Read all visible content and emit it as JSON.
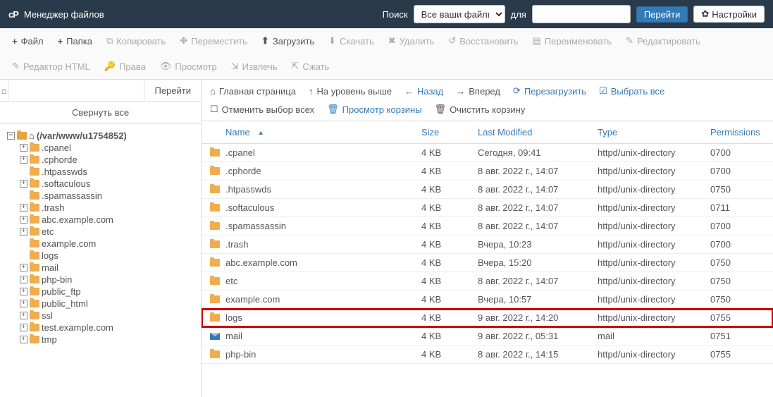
{
  "header": {
    "title": "Менеджер файлов",
    "searchLabel": "Поиск",
    "scopeSelected": "Все ваши файлы",
    "forLabel": "для",
    "goLabel": "Перейти",
    "settingsLabel": "Настройки"
  },
  "toolbar": {
    "file": "Файл",
    "folder": "Папка",
    "copy": "Копировать",
    "move": "Переместить",
    "upload": "Загрузить",
    "download": "Скачать",
    "delete": "Удалить",
    "restore": "Восстановить",
    "rename": "Переименовать",
    "edit": "Редактировать",
    "htmlEditor": "Редактор HTML",
    "perms": "Права",
    "view": "Просмотр",
    "extract": "Извлечь",
    "compress": "Сжать"
  },
  "left": {
    "goLabel": "Перейти",
    "collapseAll": "Свернуть все",
    "rootLabel": "(/var/www/u1754852)",
    "tree": [
      {
        "label": ".cpanel",
        "exp": "+"
      },
      {
        "label": ".cphorde",
        "exp": "+"
      },
      {
        "label": ".htpasswds",
        "exp": ""
      },
      {
        "label": ".softaculous",
        "exp": "+"
      },
      {
        "label": ".spamassassin",
        "exp": ""
      },
      {
        "label": ".trash",
        "exp": "+"
      },
      {
        "label": "abc.example.com",
        "exp": "+"
      },
      {
        "label": "etc",
        "exp": "+"
      },
      {
        "label": "example.com",
        "exp": ""
      },
      {
        "label": "logs",
        "exp": ""
      },
      {
        "label": "mail",
        "exp": "+"
      },
      {
        "label": "php-bin",
        "exp": "+"
      },
      {
        "label": "public_ftp",
        "exp": "+"
      },
      {
        "label": "public_html",
        "exp": "+"
      },
      {
        "label": "ssl",
        "exp": "+"
      },
      {
        "label": "test.example.com",
        "exp": "+"
      },
      {
        "label": "tmp",
        "exp": "+"
      }
    ]
  },
  "actions": {
    "home": "Главная страница",
    "up": "На уровень выше",
    "back": "Назад",
    "fwd": "Вперед",
    "reload": "Перезагрузить",
    "selectAll": "Выбрать все",
    "deselect": "Отменить выбор всех",
    "viewTrash": "Просмотр корзины",
    "emptyTrash": "Очистить корзину"
  },
  "columns": {
    "name": "Name",
    "size": "Size",
    "modified": "Last Modified",
    "type": "Type",
    "perms": "Permissions"
  },
  "files": [
    {
      "name": ".cpanel",
      "size": "4 KB",
      "mod": "Сегодня, 09:41",
      "type": "httpd/unix-directory",
      "perm": "0700",
      "icon": "folder"
    },
    {
      "name": ".cphorde",
      "size": "4 KB",
      "mod": "8 авг. 2022 г., 14:07",
      "type": "httpd/unix-directory",
      "perm": "0700",
      "icon": "folder"
    },
    {
      "name": ".htpasswds",
      "size": "4 KB",
      "mod": "8 авг. 2022 г., 14:07",
      "type": "httpd/unix-directory",
      "perm": "0750",
      "icon": "folder"
    },
    {
      "name": ".softaculous",
      "size": "4 KB",
      "mod": "8 авг. 2022 г., 14:07",
      "type": "httpd/unix-directory",
      "perm": "0711",
      "icon": "folder"
    },
    {
      "name": ".spamassassin",
      "size": "4 KB",
      "mod": "8 авг. 2022 г., 14:07",
      "type": "httpd/unix-directory",
      "perm": "0700",
      "icon": "folder"
    },
    {
      "name": ".trash",
      "size": "4 KB",
      "mod": "Вчера, 10:23",
      "type": "httpd/unix-directory",
      "perm": "0700",
      "icon": "folder"
    },
    {
      "name": "abc.example.com",
      "size": "4 KB",
      "mod": "Вчера, 15:20",
      "type": "httpd/unix-directory",
      "perm": "0750",
      "icon": "folder"
    },
    {
      "name": "etc",
      "size": "4 KB",
      "mod": "8 авг. 2022 г., 14:07",
      "type": "httpd/unix-directory",
      "perm": "0750",
      "icon": "folder"
    },
    {
      "name": "example.com",
      "size": "4 KB",
      "mod": "Вчера, 10:57",
      "type": "httpd/unix-directory",
      "perm": "0750",
      "icon": "folder"
    },
    {
      "name": "logs",
      "size": "4 KB",
      "mod": "9 авг. 2022 г., 14:20",
      "type": "httpd/unix-directory",
      "perm": "0755",
      "icon": "folder",
      "highlight": true
    },
    {
      "name": "mail",
      "size": "4 KB",
      "mod": "9 авг. 2022 г., 05:31",
      "type": "mail",
      "perm": "0751",
      "icon": "mail"
    },
    {
      "name": "php-bin",
      "size": "4 KB",
      "mod": "8 авг. 2022 г., 14:15",
      "type": "httpd/unix-directory",
      "perm": "0755",
      "icon": "folder"
    }
  ]
}
